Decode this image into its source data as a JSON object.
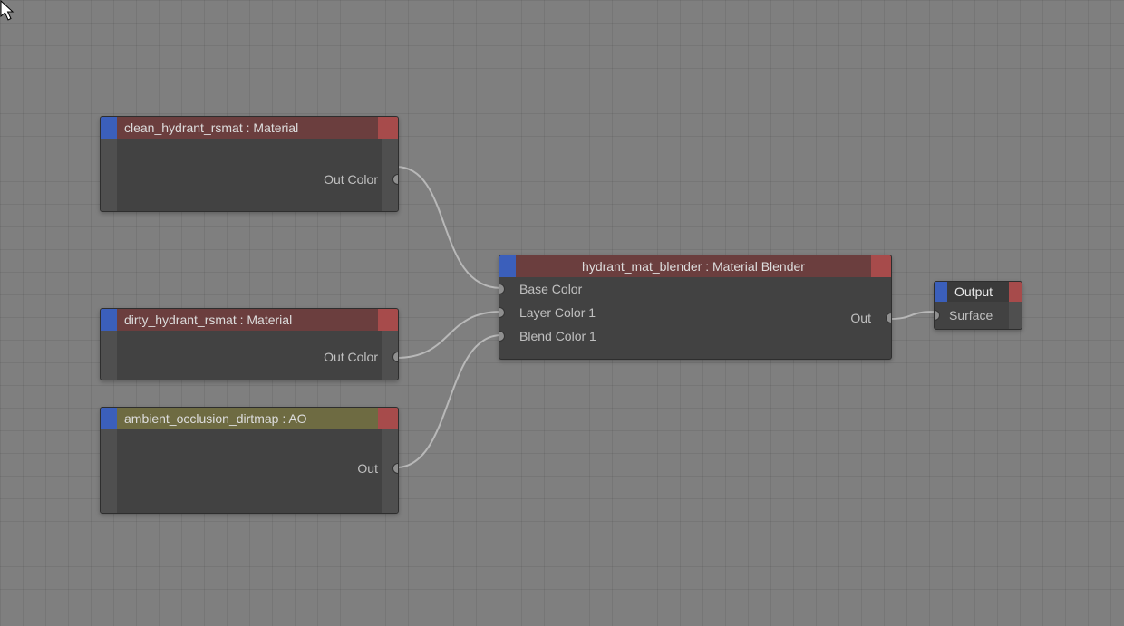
{
  "nodes": {
    "clean_hydrant": {
      "title": "clean_hydrant_rsmat : Material",
      "out": "Out Color"
    },
    "dirty_hydrant": {
      "title": "dirty_hydrant_rsmat : Material",
      "out": "Out Color"
    },
    "ao": {
      "title": "ambient_occlusion_dirtmap : AO",
      "out": "Out"
    },
    "blender": {
      "title": "hydrant_mat_blender : Material Blender",
      "in1": "Base Color",
      "in2": "Layer Color 1",
      "in3": "Blend Color 1",
      "out": "Out"
    },
    "output": {
      "title": "Output",
      "in": "Surface"
    }
  }
}
